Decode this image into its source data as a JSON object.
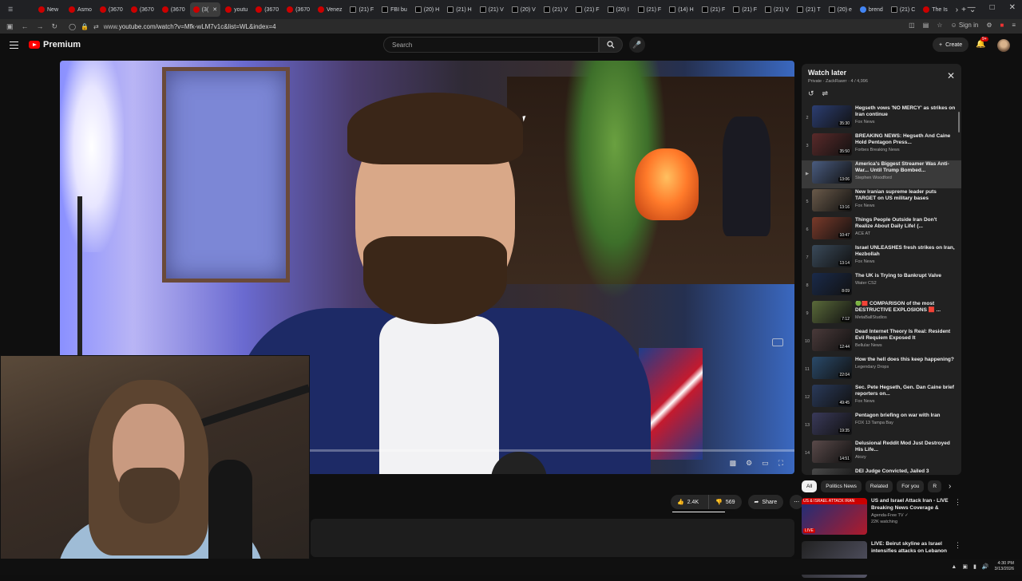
{
  "browser": {
    "tabs": [
      {
        "label": "",
        "icon": "tab-list-icon",
        "kind": "menu"
      },
      {
        "label": "New",
        "kind": "y"
      },
      {
        "label": "Asmo",
        "kind": "y"
      },
      {
        "label": "(3670",
        "kind": "y"
      },
      {
        "label": "(3670",
        "kind": "y"
      },
      {
        "label": "(3670",
        "kind": "y"
      },
      {
        "label": "(3(",
        "kind": "y",
        "active": true
      },
      {
        "label": "youtu",
        "kind": "y"
      },
      {
        "label": "(3670",
        "kind": "y"
      },
      {
        "label": "(3670",
        "kind": "y"
      },
      {
        "label": "Venez",
        "kind": "y"
      },
      {
        "label": "(21) F",
        "kind": "x"
      },
      {
        "label": "FBI bu",
        "kind": "x"
      },
      {
        "label": "(20) H",
        "kind": "x"
      },
      {
        "label": "(21) H",
        "kind": "x"
      },
      {
        "label": "(21) V",
        "kind": "x"
      },
      {
        "label": "(20) V",
        "kind": "x"
      },
      {
        "label": "(21) V",
        "kind": "x"
      },
      {
        "label": "(21) F",
        "kind": "x"
      },
      {
        "label": "(20) I",
        "kind": "x"
      },
      {
        "label": "(21) F",
        "kind": "x"
      },
      {
        "label": "(14) H",
        "kind": "x"
      },
      {
        "label": "(21) F",
        "kind": "x"
      },
      {
        "label": "(21) F",
        "kind": "x"
      },
      {
        "label": "(21) V",
        "kind": "x"
      },
      {
        "label": "(21) T",
        "kind": "x"
      },
      {
        "label": "(20) e",
        "kind": "x"
      },
      {
        "label": "brend",
        "kind": "g"
      },
      {
        "label": "(21) C",
        "kind": "x"
      },
      {
        "label": "The Is",
        "kind": "y"
      }
    ],
    "url_prefix": "www.",
    "url": "youtube.com/watch?v=Mfk-wLM7v1c&list=WL&index=4",
    "signin_label": "Sign in"
  },
  "youtube": {
    "logo_text": "Premium",
    "search_placeholder": "Search",
    "create_label": "Create",
    "notif_count": "9+"
  },
  "video": {
    "progress_fraction": 0.02,
    "likes": "2.4K",
    "dislikes": "569",
    "share_label": "Share"
  },
  "playlist": {
    "title": "Watch later",
    "subtitle": "Private · ZackRawrr · 4 / 4,996",
    "items": [
      {
        "index": "2",
        "duration": "35:30",
        "title": "Hegseth vows 'NO MERCY' as strikes on Iran continue",
        "channel": "Fox News",
        "color": "#2c3e72"
      },
      {
        "index": "3",
        "duration": "35:50",
        "title": "BREAKING NEWS: Hegseth And Caine Hold Pentagon Press...",
        "channel": "Forbes Breaking News",
        "color": "#5a2a2a"
      },
      {
        "index": "▶",
        "duration": "13:06",
        "title": "America's Biggest Streamer Was Anti-War... Until Trump Bombed...",
        "channel": "Stephen Woodford",
        "color": "#4a5c80",
        "active": true
      },
      {
        "index": "5",
        "duration": "13:16",
        "title": "New Iranian supreme leader puts TARGET on US military bases",
        "channel": "Fox News",
        "color": "#6a5a4a"
      },
      {
        "index": "6",
        "duration": "10:47",
        "title": "Things People Outside Iran Don't Realize About Daily Life! (...",
        "channel": "ACE AT",
        "color": "#7a3a2a"
      },
      {
        "index": "7",
        "duration": "13:14",
        "title": "Israel UNLEASHES fresh strikes on Iran, Hezbollah",
        "channel": "Fox News",
        "color": "#3a4a5a"
      },
      {
        "index": "8",
        "duration": "8:09",
        "title": "The UK is Trying to Bankrupt Valve",
        "channel": "Water CS2",
        "color": "#1a2a4a"
      },
      {
        "index": "9",
        "duration": "7:12",
        "title": "🟢🟥 COMPARISON of the most DESTRUCTIVE EXPLOSIONS 🟥 ...",
        "channel": "MetaBallStudios",
        "color": "#5a6a3a"
      },
      {
        "index": "10",
        "duration": "12:44",
        "title": "Dead Internet Theory Is Real: Resident Evil Requiem Exposed It",
        "channel": "Bellular News",
        "color": "#4a3a3a"
      },
      {
        "index": "11",
        "duration": "22:04",
        "title": "How the hell does this keep happening?",
        "channel": "Legendary Drops",
        "color": "#2a4a6a"
      },
      {
        "index": "12",
        "duration": "49:45",
        "title": "Sec. Pete Hegseth, Gen. Dan Caine brief reporters on...",
        "channel": "Fox News",
        "color": "#2a3a5a"
      },
      {
        "index": "13",
        "duration": "19:35",
        "title": "Pentagon briefing on war with Iran",
        "channel": "FOX 13 Tampa Bay",
        "color": "#3a3a5a"
      },
      {
        "index": "14",
        "duration": "14:51",
        "title": "Delusional Reddit Mod Just Destroyed His Life...",
        "channel": "Atozy",
        "color": "#5a4a4a"
      },
      {
        "index": "15",
        "duration": "",
        "title": "DEI Judge Convicted, Jailed 3",
        "channel": "",
        "color": "#4a4a4a"
      }
    ]
  },
  "chips": [
    {
      "label": "All",
      "active": true
    },
    {
      "label": "Politics News"
    },
    {
      "label": "Related"
    },
    {
      "label": "For you"
    },
    {
      "label": "R"
    }
  ],
  "related": [
    {
      "title": "US and Israel Attack Iran - LIVE Breaking News Coverage & Wa...",
      "channel": "Agenda-Free TV ✓",
      "meta": "22K watching",
      "ribbon": "US & ISRAEL ATTACK IRAN",
      "badge": "LIVE"
    },
    {
      "title": "LIVE: Beirut skyline as Israel intensifies attacks on Lebanon",
      "channel": "",
      "meta": "",
      "ribbon": "",
      "badge": ""
    }
  ],
  "taskbar": {
    "time": "4:30 PM",
    "date": "3/13/2026"
  }
}
